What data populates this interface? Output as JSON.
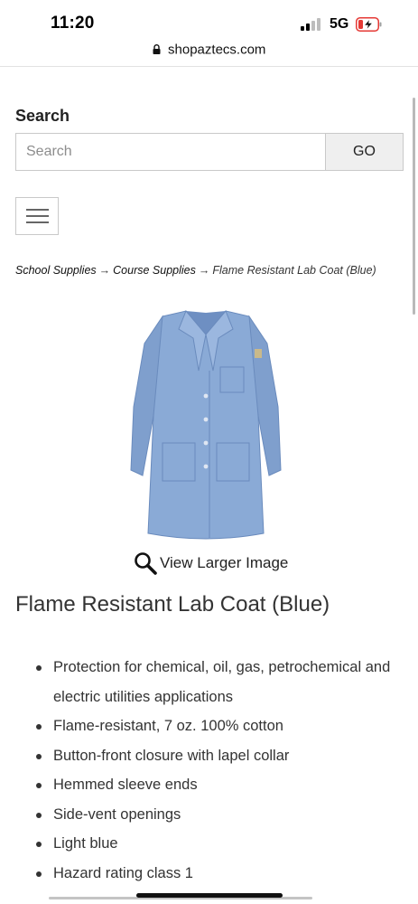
{
  "status_bar": {
    "time": "11:20",
    "network": "5G",
    "signal_bars_active": 2,
    "battery_charging": true,
    "battery_color": "#e53935"
  },
  "browser": {
    "url": "shopaztecs.com"
  },
  "search": {
    "label": "Search",
    "placeholder": "Search",
    "value": "",
    "button_label": "GO"
  },
  "breadcrumb": {
    "items": [
      "School Supplies",
      "Course Supplies"
    ],
    "separator": "→",
    "current": "Flame Resistant Lab Coat (Blue)"
  },
  "product": {
    "image_icon": "lab-coat-image",
    "image_color": "#8aaad6",
    "view_larger_label": "View Larger Image",
    "title": "Flame Resistant Lab Coat (Blue)",
    "features": [
      "Protection for chemical, oil, gas, petrochemical and electric utilities applications",
      "Flame-resistant, 7 oz. 100% cotton",
      "Button-front closure with lapel collar",
      "Hemmed sleeve ends",
      "Side-vent openings",
      "Light blue",
      "Hazard rating class 1"
    ]
  }
}
